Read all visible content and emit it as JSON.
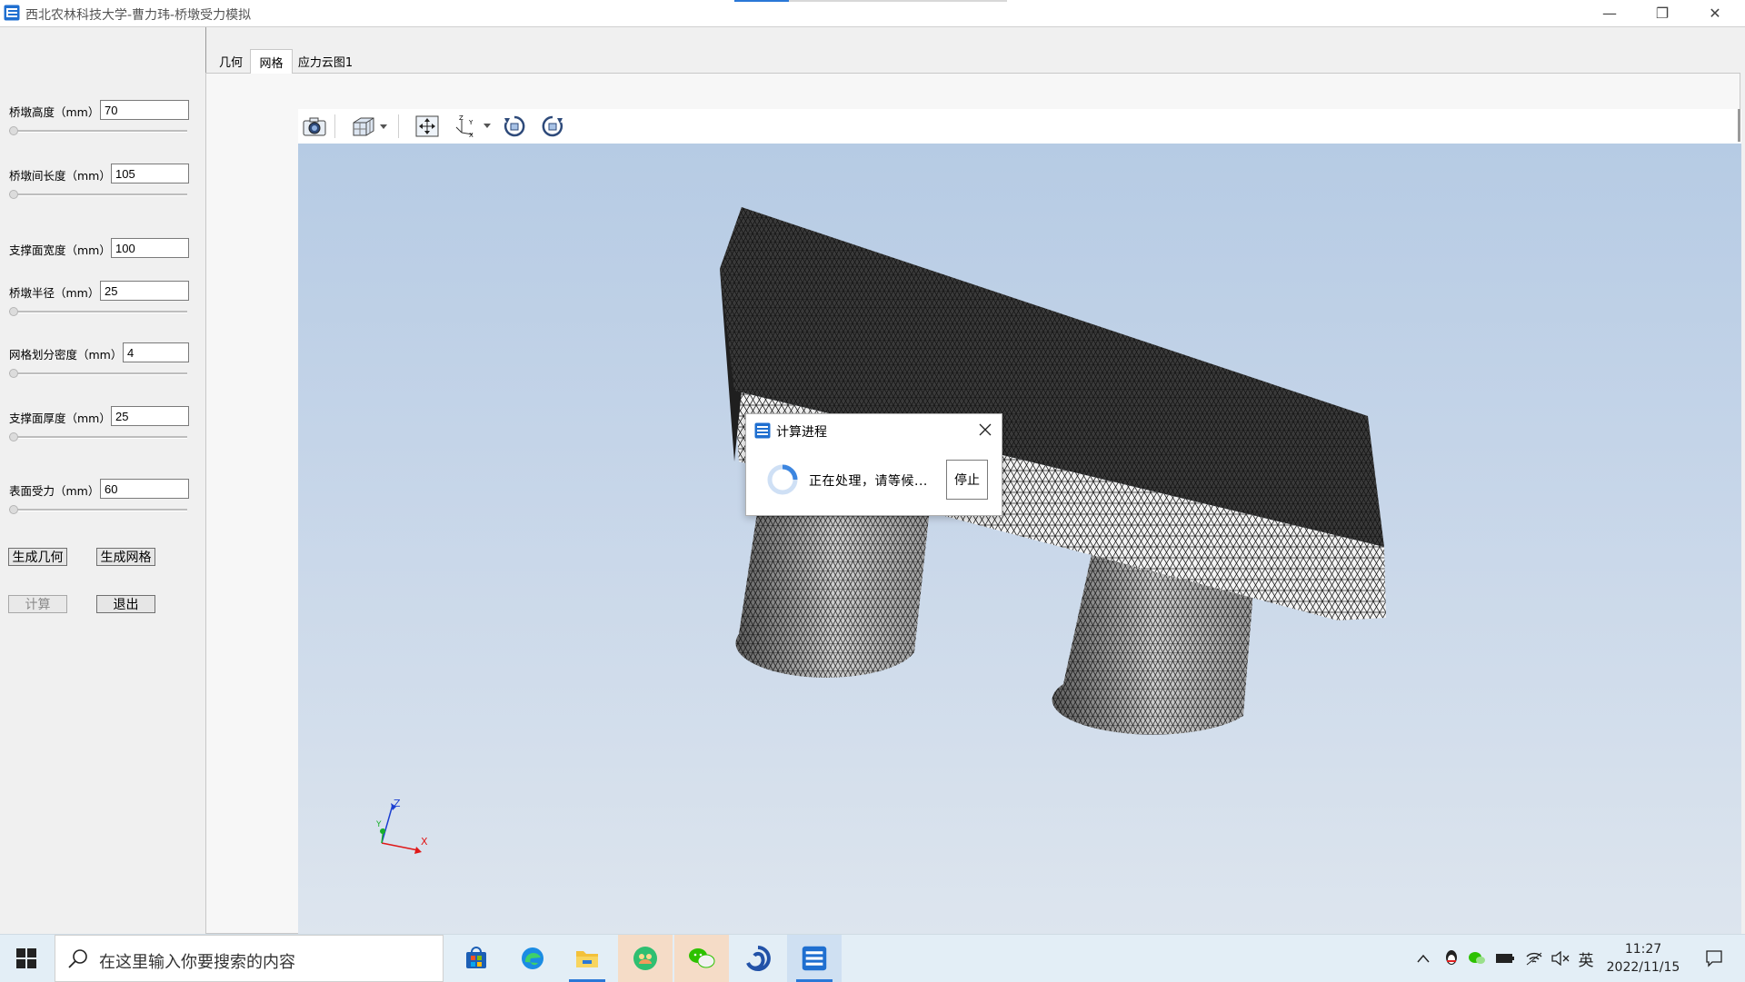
{
  "window": {
    "title": "西北农林科技大学-曹力玮-桥墩受力模拟",
    "minimize_glyph": "—",
    "maximize_glyph": "❐",
    "close_glyph": "✕"
  },
  "params": [
    {
      "label": "桥墩高度（mm）",
      "value": "70",
      "slider": 0
    },
    {
      "label": "桥墩间长度（mm）",
      "value": "105",
      "slider": 0
    },
    {
      "label": "支撑面宽度（mm）",
      "value": "100"
    },
    {
      "label": "桥墩半径（mm）",
      "value": "25",
      "slider": 0
    },
    {
      "label": "网格划分密度（mm）",
      "value": "4",
      "slider": 0
    },
    {
      "label": "支撑面厚度（mm）",
      "value": "25",
      "slider": 0
    },
    {
      "label": "表面受力（mm）",
      "value": "60",
      "slider": 0
    }
  ],
  "buttons": {
    "gen_geometry": "生成几何",
    "gen_mesh": "生成网格",
    "compute": "计算",
    "exit": "退出"
  },
  "tabs": [
    {
      "label": "几何",
      "active": false
    },
    {
      "label": "网格",
      "active": true
    },
    {
      "label": "应力云图1",
      "active": false
    }
  ],
  "toolbar_icons": [
    "camera-icon",
    "view-cube-icon",
    "fit-all-icon",
    "axes-orientation-icon",
    "rotate-ccw-icon",
    "rotate-cw-icon"
  ],
  "axes": {
    "x": "X",
    "y": "Y",
    "z": "Z"
  },
  "dialog": {
    "title": "计算进程",
    "message": "正在处理，请等候...",
    "stop_label": "停止"
  },
  "taskbar": {
    "search_placeholder": "在这里输入你要搜索的内容",
    "time": "11:27",
    "date": "2022/11/15",
    "ime": "英"
  },
  "colors": {
    "accent": "#2a78d7",
    "viewer_top": "#b6cbe4",
    "viewer_bottom": "#dde5ee"
  }
}
